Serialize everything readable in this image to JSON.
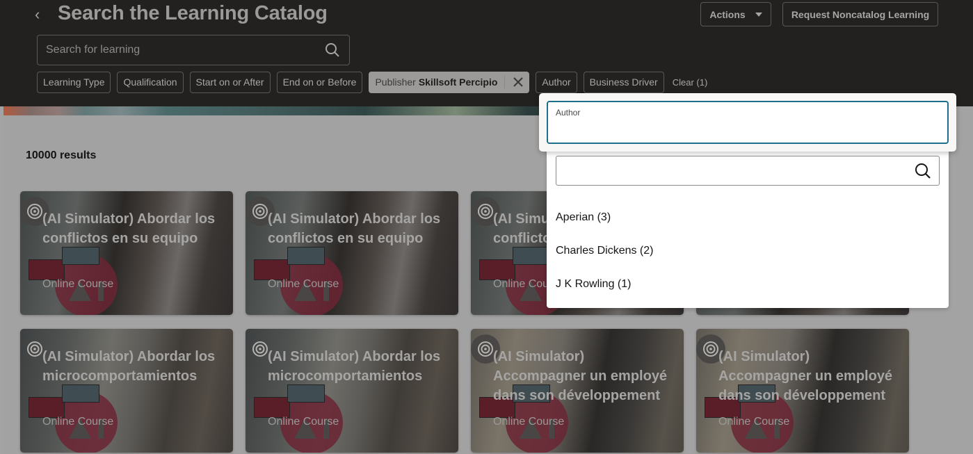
{
  "header": {
    "title": "Search the Learning Catalog",
    "actions_label": "Actions",
    "request_label": "Request Noncatalog Learning",
    "search_placeholder": "Search for learning",
    "search_value": ""
  },
  "filters": {
    "chips": [
      {
        "label": "Learning Type"
      },
      {
        "label": "Qualification"
      },
      {
        "label": "Start on or After"
      },
      {
        "label": "End on or Before"
      }
    ],
    "active_chip": {
      "label": "Publisher",
      "value": "Skillsoft Percipio"
    },
    "chips_after": [
      {
        "label": "Author"
      },
      {
        "label": "Business Driver"
      }
    ],
    "clear_label": "Clear (1)"
  },
  "results": {
    "count_label": "10000 results"
  },
  "cards": [
    {
      "title": "(AI Simulator) Abordar los conflictos en su equipo",
      "type": "Online Course"
    },
    {
      "title": "(AI Simulator) Abordar los conflictos en su equipo",
      "type": "Online Course"
    },
    {
      "title": "(AI Simulator) Abordar los conflictos en su equipo",
      "type": "Online Course"
    },
    {
      "title": "(AI Simulator) Abordar los microcomportamientos",
      "type": "Online Course"
    },
    {
      "title": "(AI Simulator) Abordar los microcomportamientos",
      "type": "Online Course"
    },
    {
      "title": "(AI Simulator) Accompagner un employé dans son développement",
      "type": "Online Course"
    },
    {
      "title": "(AI Simulator) Accompagner un employé dans son développement",
      "type": "Online Course"
    }
  ],
  "author_popup": {
    "field_label": "Author",
    "field_value": "",
    "search_value": "",
    "options": [
      {
        "label": "Aperian (3)"
      },
      {
        "label": "Charles Dickens (2)"
      },
      {
        "label": "J K Rowling (1)"
      }
    ]
  },
  "colors": {
    "header_bg": "#232020",
    "focus_border": "#1b6e8c",
    "overlay_bg": "#a2a2a2"
  }
}
